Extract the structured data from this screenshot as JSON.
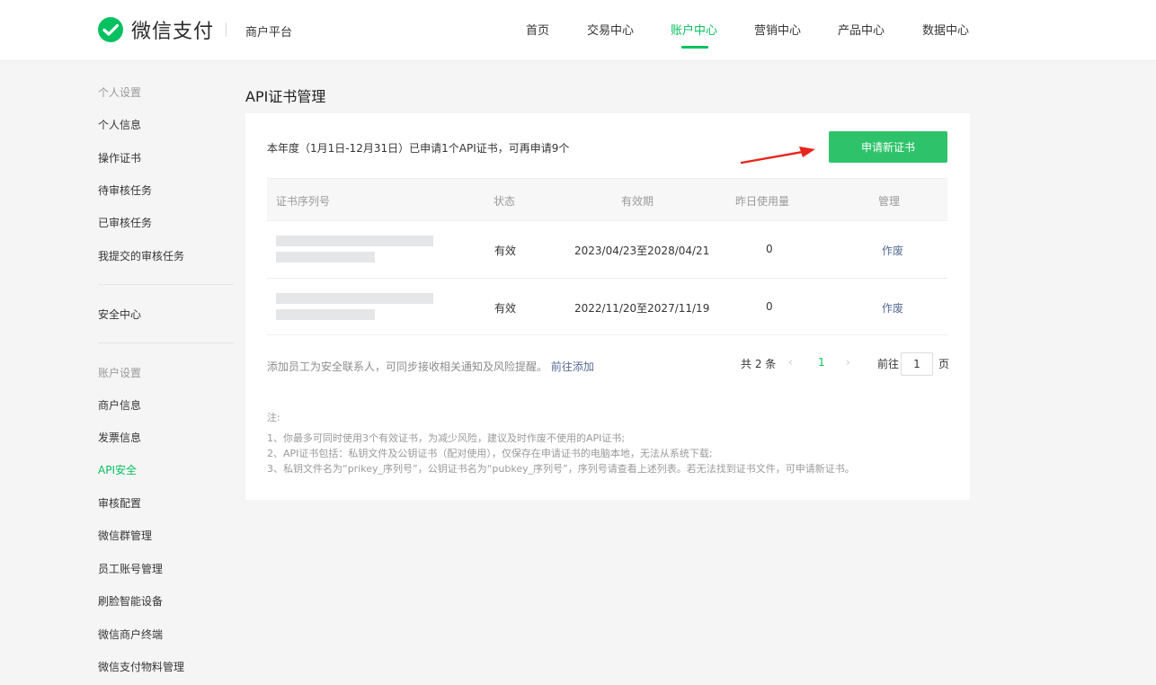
{
  "brand": {
    "name": "微信支付",
    "platform": "商户平台",
    "accent": "#07c160"
  },
  "nav": {
    "items": [
      "首页",
      "交易中心",
      "账户中心",
      "营销中心",
      "产品中心",
      "数据中心"
    ],
    "active": "账户中心"
  },
  "sidebar": {
    "group_personal": "个人设置",
    "personal_items": [
      "个人信息",
      "操作证书",
      "待审核任务",
      "已审核任务",
      "我提交的审核任务"
    ],
    "security_center": "安全中心",
    "group_account": "账户设置",
    "account_items": [
      "商户信息",
      "发票信息",
      "API安全",
      "审核配置",
      "微信群管理",
      "员工账号管理",
      "刷脸智能设备",
      "微信商户终端",
      "微信支付物料管理"
    ],
    "active": "API安全"
  },
  "main": {
    "title": "API证书管理",
    "quota_text": "本年度（1月1日-12月31日）已申请1个API证书，可再申请9个",
    "apply_button": "申请新证书",
    "table": {
      "headers": [
        "证书序列号",
        "状态",
        "有效期",
        "昨日使用量",
        "管理"
      ],
      "rows": [
        {
          "status": "有效",
          "validity": "2023/04/23至2028/04/21",
          "usage": "0",
          "action": "作废"
        },
        {
          "status": "有效",
          "validity": "2022/11/20至2027/11/19",
          "usage": "0",
          "action": "作废"
        }
      ]
    },
    "contact_tip": "添加员工为安全联系人，可同步接收相关通知及风险提醒。",
    "contact_link": "前往添加",
    "pagination": {
      "total": "共 2 条",
      "prev": "‹",
      "current": "1",
      "next": "›",
      "goto": "前往",
      "page_value": "1",
      "page_unit": "页"
    },
    "notes": {
      "heading": "注:",
      "lines": [
        "1、你最多可同时使用3个有效证书，为减少风险，建议及时作废不使用的API证书;",
        "2、API证书包括：私钥文件及公钥证书（配对使用），仅保存在申请证书的电脑本地，无法从系统下载;",
        "3、私钥文件名为“prikey_序列号”，公钥证书名为“pubkey_序列号”，序列号请查看上述列表。若无法找到证书文件，可申请新证书。"
      ]
    }
  }
}
